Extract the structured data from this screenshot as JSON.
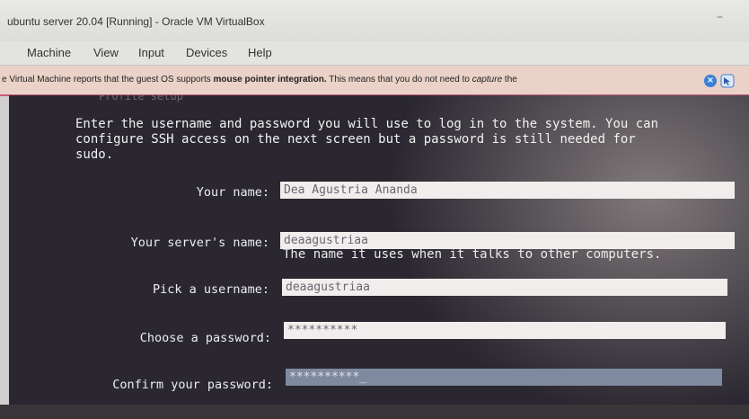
{
  "window": {
    "title": "ubuntu server 20.04 [Running] - Oracle VM VirtualBox",
    "minimize_glyph": "–"
  },
  "menubar": {
    "items": [
      "Machine",
      "View",
      "Input",
      "Devices",
      "Help"
    ]
  },
  "notification": {
    "text_pre": "e Virtual Machine reports that the guest OS supports ",
    "text_bold": "mouse pointer integration.",
    "text_mid": " This means that you do not need to ",
    "text_italic": "capture",
    "text_post": " the",
    "close_icon": "close-icon",
    "pointer_icon": "mouse-pointer-icon",
    "close_color": "#3a80d8"
  },
  "guest": {
    "faint_header": "Profile setup",
    "intro": "Enter the username and password you will use to log in to the system. You can\nconfigure SSH access on the next screen but a password is still needed for\nsudo.",
    "fields": {
      "name": {
        "label": "Your name:",
        "value": "Dea Agustria Ananda"
      },
      "server": {
        "label": "Your server's name:",
        "value": "deaagustriaa",
        "hint": "The name it uses when it talks to other computers."
      },
      "username": {
        "label": "Pick a username:",
        "value": "deaagustriaa"
      },
      "password": {
        "label": "Choose a password:",
        "value": "**********"
      },
      "confirm": {
        "label": "Confirm your password:",
        "value": "**********_"
      }
    }
  }
}
